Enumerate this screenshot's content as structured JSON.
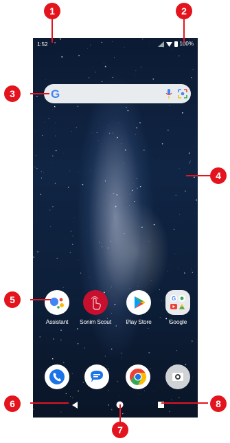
{
  "status_bar": {
    "time": "1:52",
    "battery": "100%"
  },
  "search_bar": {
    "logo": "G"
  },
  "apps": [
    {
      "label": "Assistant",
      "icon": "assistant-icon"
    },
    {
      "label": "Sonim Scout",
      "icon": "sonim-scout-icon"
    },
    {
      "label": "Play Store",
      "icon": "play-store-icon"
    },
    {
      "label": "Google",
      "icon": "google-folder-icon"
    }
  ],
  "dock": [
    {
      "icon": "phone-icon"
    },
    {
      "icon": "messages-icon"
    },
    {
      "icon": "chrome-icon"
    },
    {
      "icon": "camera-icon"
    }
  ],
  "callouts": [
    "1",
    "2",
    "3",
    "4",
    "5",
    "6",
    "7",
    "8"
  ],
  "colors": {
    "callout": "#e3141e",
    "search_bg": "#e9ecef",
    "sky": "#102544"
  }
}
